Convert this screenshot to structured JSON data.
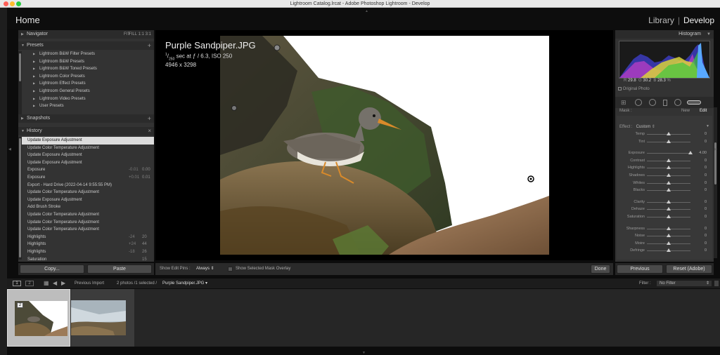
{
  "window": {
    "title": "Lightroom Catalog.lrcat - Adobe Photoshop Lightroom - Develop"
  },
  "topbar": {
    "home": "Home",
    "modules": [
      "Library",
      "Develop"
    ],
    "active_module": "Develop"
  },
  "navigator": {
    "label": "Navigator",
    "zoom": [
      "FIT",
      "FILL",
      "1:1",
      "3:1"
    ]
  },
  "presets": {
    "label": "Presets",
    "add": "+",
    "items": [
      "Lightroom B&W Filter Presets",
      "Lightroom B&W Presets",
      "Lightroom B&W Toned Presets",
      "Lightroom Color Presets",
      "Lightroom Effect Presets",
      "Lightroom General Presets",
      "Lightroom Video Presets",
      "User Presets"
    ]
  },
  "snapshots": {
    "label": "Snapshots",
    "add": "+"
  },
  "history": {
    "label": "History",
    "close": "×",
    "items": [
      {
        "name": "Update Exposure Adjustment",
        "v1": "",
        "v2": ""
      },
      {
        "name": "Update Color Temperature Adjustment",
        "v1": "",
        "v2": ""
      },
      {
        "name": "Update Exposure Adjustment",
        "v1": "",
        "v2": ""
      },
      {
        "name": "Update Exposure Adjustment",
        "v1": "",
        "v2": ""
      },
      {
        "name": "Exposure",
        "v1": "-0.01",
        "v2": "0.00"
      },
      {
        "name": "Exposure",
        "v1": "+0.01",
        "v2": "0.01"
      },
      {
        "name": "Export - Hard Drive (2022-04-14 9:55:55 PM)",
        "v1": "",
        "v2": ""
      },
      {
        "name": "Update Color Temperature Adjustment",
        "v1": "",
        "v2": ""
      },
      {
        "name": "Update Exposure Adjustment",
        "v1": "",
        "v2": ""
      },
      {
        "name": "Add Brush Stroke",
        "v1": "",
        "v2": ""
      },
      {
        "name": "Update Color Temperature Adjustment",
        "v1": "",
        "v2": ""
      },
      {
        "name": "Update Color Temperature Adjustment",
        "v1": "",
        "v2": ""
      },
      {
        "name": "Update Color Temperature Adjustment",
        "v1": "",
        "v2": ""
      },
      {
        "name": "Highlights",
        "v1": "-24",
        "v2": "20"
      },
      {
        "name": "Highlights",
        "v1": "+24",
        "v2": "44"
      },
      {
        "name": "Highlights",
        "v1": "-18",
        "v2": "26"
      },
      {
        "name": "Saturation",
        "v1": "",
        "v2": "15"
      }
    ]
  },
  "left_buttons": {
    "copy": "Copy...",
    "paste": "Paste"
  },
  "photo_info": {
    "filename": "Purple Sandpiper.JPG",
    "exposure_num": "1",
    "exposure_den": "250",
    "exposure_rest": "sec at ƒ / 6.3, ISO 250",
    "dimensions": "4946 x 3298"
  },
  "toolbar": {
    "show_edit_pins_label": "Show Edit Pins :",
    "show_edit_pins_value": "Always",
    "mask_overlay_label": "Show Selected Mask Overlay",
    "done": "Done"
  },
  "histogram": {
    "label": "Histogram",
    "r_label": "R",
    "r": "29.8",
    "g_label": "G",
    "g": "30.2",
    "b_label": "B",
    "b": "28.3",
    "unit": "%",
    "original_photo": "Original Photo"
  },
  "mask": {
    "label": "Mask :",
    "new": "New",
    "edit": "Edit"
  },
  "effect": {
    "label": "Effect :",
    "value": "Custom"
  },
  "sliders": [
    {
      "label": "Temp",
      "value": "0",
      "level": 0.5
    },
    {
      "label": "Tint",
      "value": "0",
      "level": 0.5
    },
    {
      "label": "Exposure",
      "value": "4.00",
      "level": 1.0
    },
    {
      "label": "Contrast",
      "value": "0",
      "level": 0.5
    },
    {
      "label": "Highlights",
      "value": "0",
      "level": 0.5
    },
    {
      "label": "Shadows",
      "value": "0",
      "level": 0.5
    },
    {
      "label": "Whites",
      "value": "0",
      "level": 0.5
    },
    {
      "label": "Blacks",
      "value": "0",
      "level": 0.5
    },
    {
      "label": "Clarity",
      "value": "0",
      "level": 0.5
    },
    {
      "label": "Dehaze",
      "value": "0",
      "level": 0.5
    },
    {
      "label": "Saturation",
      "value": "0",
      "level": 0.5
    },
    {
      "label": "Sharpness",
      "value": "0",
      "level": 0.5
    },
    {
      "label": "Noise",
      "value": "0",
      "level": 0.5
    },
    {
      "label": "Moire",
      "value": "0",
      "level": 0.5
    },
    {
      "label": "Defringe",
      "value": "0",
      "level": 0.5
    }
  ],
  "right_buttons": {
    "previous": "Previous",
    "reset": "Reset (Adobe)"
  },
  "filmbar": {
    "view1": "1",
    "view2": "2",
    "source": "Previous Import",
    "count": "2 photos /1 selected /",
    "selected_file": "Purple Sandpiper.JPG",
    "filter_label": "Filter :",
    "filter_value": "No Filter"
  },
  "thumbnails": [
    {
      "badge": "2"
    },
    {
      "badge": ""
    }
  ],
  "colors": {
    "accent": "#d8d8d8",
    "background": "#0c0c0c",
    "panel": "#333333"
  }
}
